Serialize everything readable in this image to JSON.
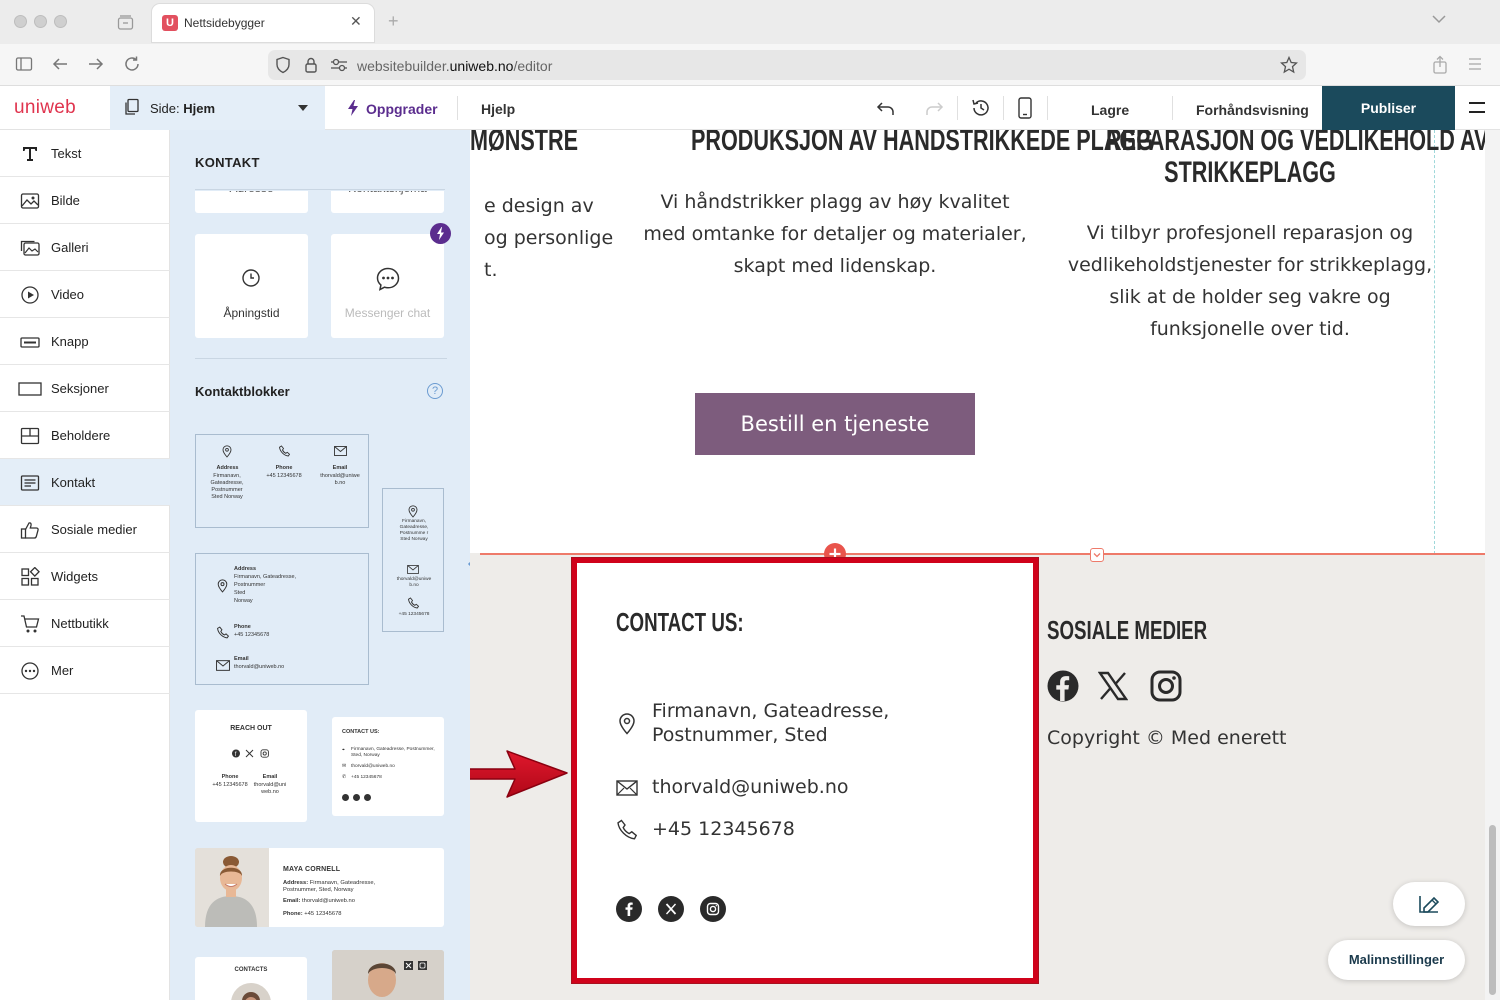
{
  "browser": {
    "tab_title": "Nettsidebygger",
    "url_prefix": "websitebuilder.",
    "url_domain": "uniweb.no",
    "url_path": "/editor"
  },
  "toolbar": {
    "logo": "uniweb",
    "page_prefix": "Side:",
    "page_name": "Hjem",
    "upgrade": "Oppgrader",
    "help": "Hjelp",
    "save": "Lagre",
    "preview": "Forhåndsvisning",
    "publish": "Publiser",
    "accent": "#1b4a5c"
  },
  "sidebar": {
    "items": [
      {
        "label": "Tekst",
        "icon": "text-icon"
      },
      {
        "label": "Bilde",
        "icon": "image-icon"
      },
      {
        "label": "Galleri",
        "icon": "gallery-icon"
      },
      {
        "label": "Video",
        "icon": "video-icon"
      },
      {
        "label": "Knapp",
        "icon": "button-icon"
      },
      {
        "label": "Seksjoner",
        "icon": "sections-icon"
      },
      {
        "label": "Beholdere",
        "icon": "containers-icon"
      },
      {
        "label": "Kontakt",
        "icon": "contact-icon"
      },
      {
        "label": "Sosiale medier",
        "icon": "thumbs-up-icon"
      },
      {
        "label": "Widgets",
        "icon": "widgets-icon"
      },
      {
        "label": "Nettbutikk",
        "icon": "cart-icon"
      },
      {
        "label": "Mer",
        "icon": "more-icon"
      }
    ],
    "active": "Kontakt"
  },
  "panel": {
    "title": "KONTAKT",
    "top_cards": [
      "Adresse",
      "Kontaktskjema"
    ],
    "opening_hours": "Åpningstid",
    "messenger": "Messenger chat",
    "blocks_title": "Kontaktblokker",
    "help": "?",
    "t1": {
      "address_label": "Address",
      "address_value": "Firmanavn, Gateadresse, Postnummer Sted Norway",
      "phone_label": "Phone",
      "phone_value": "+45 12345678",
      "email_label": "Email",
      "email_value": "thorvald@uniweb.no"
    },
    "t2": {
      "address_label": "Address",
      "address_l1": "Firmanavn, Gateadresse,",
      "address_l2": "Postnummer",
      "address_l3": "Sted",
      "address_l4": "Norway",
      "phone_label": "Phone",
      "phone_value": "+45 12345678",
      "email_label": "Email",
      "email_value": "thorvald@uniweb.no"
    },
    "t3": {
      "address": "Firmanavn, Gateadresse, Postnumme r Sted Norway",
      "email": "thorvald@uniweb.no",
      "phone": "+45 12345678"
    },
    "t4": {
      "title": "REACH OUT",
      "phone_label": "Phone",
      "phone_value": "+45 12345678",
      "email_label": "Email",
      "email_value": "thorvald@uniweb.no"
    },
    "t5": {
      "title": "CONTACT US:",
      "address": "Firmanavn, Gateadresse, Postnummer, Sted, Norway",
      "email": "thorvald@uniweb.no",
      "phone": "+45 12345678"
    },
    "t6": {
      "name": "MAYA CORNELL",
      "address_label": "Address:",
      "address_value": "Firmanavn, Gateadresse, Postnummer, Sted, Norway",
      "email_label": "Email:",
      "email_value": "thorvald@uniweb.no",
      "phone_label": "Phone:",
      "phone_value": "+45 12345678"
    },
    "t7": {
      "title": "CONTACTS"
    }
  },
  "canvas": {
    "services": [
      {
        "title_line1": "MØNSTRE",
        "text_lines": [
          "e design av",
          "og personlige",
          "t."
        ]
      },
      {
        "title_line1": "PRODUKSJON AV HÅNDSTRIKKEDE PLAGG",
        "text_lines": [
          "Vi håndstrikker plagg av høy kvalitet",
          "med omtanke for detaljer og materialer,",
          "skapt med lidenskap."
        ]
      },
      {
        "title_line1": "REPARASJON OG VEDLIKEHOLD AV",
        "title_line2": "STRIKKEPLAGG",
        "text_lines": [
          "Vi tilbyr profesjonell reparasjon og",
          "vedlikeholdstjenester for strikkeplagg,",
          "slik at de holder seg vakre og",
          "funksjonelle over tid."
        ]
      }
    ],
    "cta": "Bestill en tjeneste",
    "cta_color": "#7d5c7d",
    "contact": {
      "title": "CONTACT US:",
      "address_l1": "Firmanavn, Gateadresse,",
      "address_l2": "Postnummer, Sted",
      "email": "thorvald@uniweb.no",
      "phone": "+45 12345678"
    },
    "social": {
      "title": "SOSIALE MEDIER",
      "copyright": "Copyright © Med enerett"
    },
    "template_settings": "Malinnstillinger",
    "highlight_color": "#d0021b"
  }
}
